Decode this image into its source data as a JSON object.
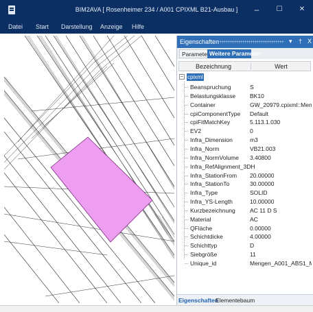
{
  "window": {
    "title": "BIM2AVA [ Rosenheimer 234 / A001 CPIXML B21-Ausbau ]",
    "controls": {
      "minimize": "–",
      "maximize": "☐",
      "close": "✕"
    }
  },
  "menu": [
    "Datei",
    "Start",
    "Darstellung",
    "Anzeige",
    "Hilfe"
  ],
  "panel": {
    "title": "Eigenschaften",
    "pin": "▾",
    "dock": "†",
    "close": "X",
    "tabs": {
      "parameter": "Parameter",
      "weitere": "Weitere Parameter"
    },
    "columns": {
      "name": "Bezeichnung",
      "value": "Wert"
    },
    "root": {
      "expander": "−",
      "label": "cpixml"
    },
    "properties": [
      {
        "name": "Beanspruchung",
        "value": "S"
      },
      {
        "name": "Belastungsklasse",
        "value": "BK10"
      },
      {
        "name": "Container",
        "value": "GW_20979.cpixml::Men..."
      },
      {
        "name": "cpiComponentType",
        "value": "Default"
      },
      {
        "name": "cpiFitMatchKey",
        "value": "5.113.1.030"
      },
      {
        "name": "EV2",
        "value": "0"
      },
      {
        "name": "Infra_Dimension",
        "value": "m3"
      },
      {
        "name": "Infra_Norm",
        "value": "VB21.003"
      },
      {
        "name": "Infra_NormVolume",
        "value": "3.40800"
      },
      {
        "name": "Infra_RefAlignment_3DHoriz",
        "value": ""
      },
      {
        "name": "Infra_StationFrom",
        "value": "20.00000"
      },
      {
        "name": "Infra_StationTo",
        "value": "30.00000"
      },
      {
        "name": "Infra_Type",
        "value": "SOLID"
      },
      {
        "name": "Infra_YS-Length",
        "value": "10.00000"
      },
      {
        "name": "Kurzbezeichnung",
        "value": "AC 11 D S"
      },
      {
        "name": "Material",
        "value": "AC"
      },
      {
        "name": "QFläche",
        "value": "0.00000"
      },
      {
        "name": "Schichtdicke",
        "value": "4.00000"
      },
      {
        "name": "Schichttyp",
        "value": "D"
      },
      {
        "name": "Siebgröße",
        "value": "11"
      },
      {
        "name": "Unique_id",
        "value": "Mengen_A001_ABS1_M..."
      }
    ],
    "bottom_tabs": {
      "eigenschaften": "Eigenschaften",
      "elementbaum": "Elementebaum"
    }
  },
  "colors": {
    "titlebar": "#0b2f63",
    "accent": "#2f6fb7",
    "selection": "#ee9ef0"
  },
  "icons": [
    "app-icon",
    "minimize-icon",
    "maximize-icon",
    "close-icon",
    "expander-icon"
  ]
}
